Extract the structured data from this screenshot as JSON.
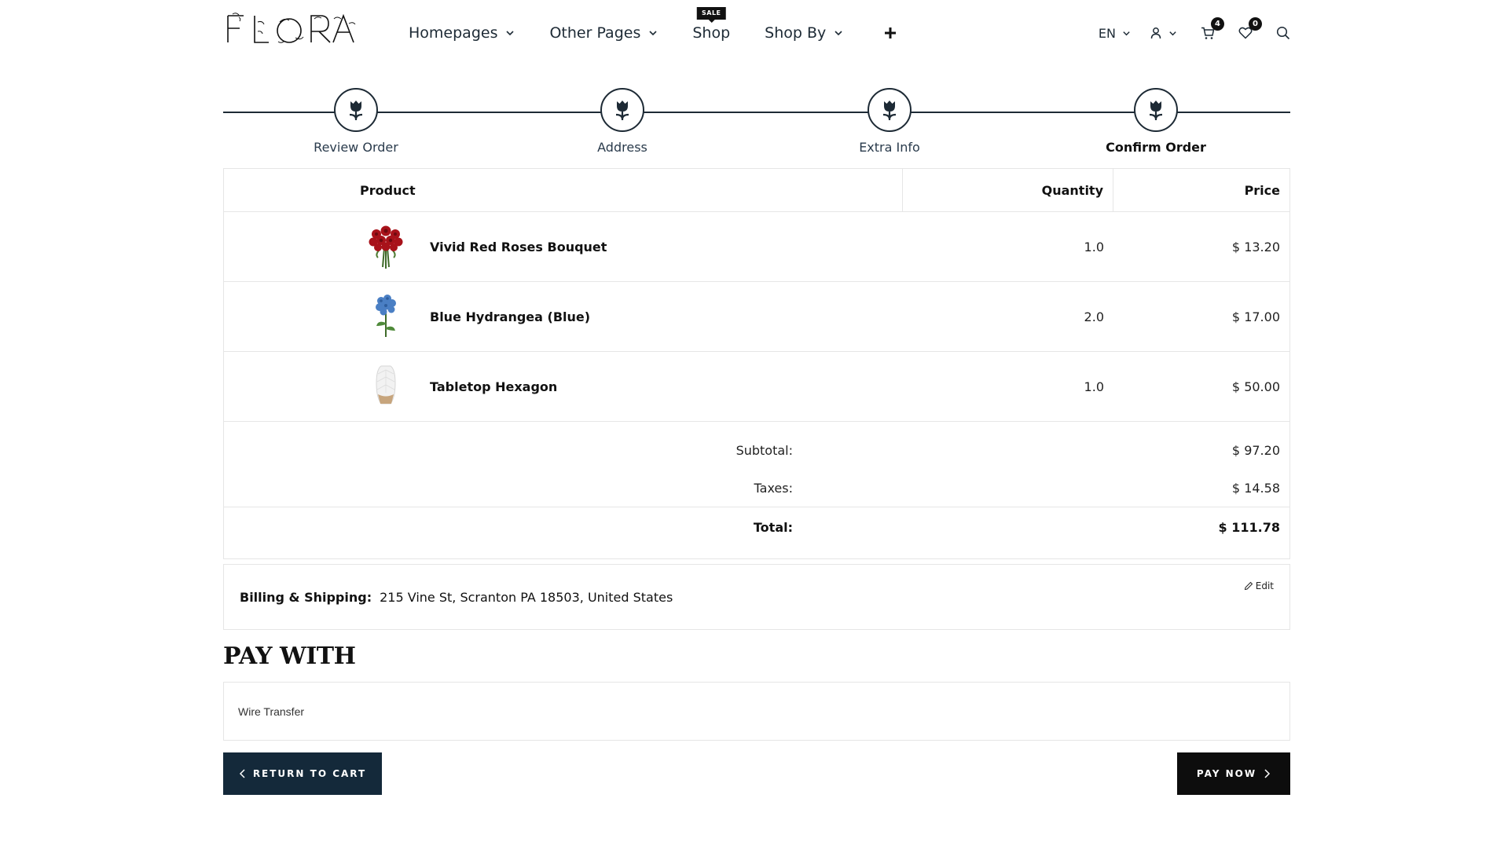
{
  "header": {
    "logo_text": "FLORA",
    "nav": [
      {
        "label": "Homepages",
        "dropdown": true
      },
      {
        "label": "Other Pages",
        "dropdown": true
      },
      {
        "label": "Shop",
        "dropdown": false,
        "badge": "SALE"
      },
      {
        "label": "Shop By",
        "dropdown": true
      }
    ],
    "plus_icon": "plus-icon",
    "language": "EN",
    "user_icon": "user-icon",
    "cart_icon": "cart-icon",
    "cart_count": "4",
    "wishlist_icon": "heart-icon",
    "wishlist_count": "0",
    "search_icon": "search-icon"
  },
  "steps": [
    {
      "label": "Review Order",
      "active": false
    },
    {
      "label": "Address",
      "active": false
    },
    {
      "label": "Extra Info",
      "active": false
    },
    {
      "label": "Confirm Order",
      "active": true
    }
  ],
  "order": {
    "columns": {
      "product": "Product",
      "quantity": "Quantity",
      "price": "Price"
    },
    "items": [
      {
        "name": "Vivid Red Roses Bouquet",
        "quantity": "1.0",
        "price": "$ 13.20",
        "thumb": "red-roses"
      },
      {
        "name": "Blue Hydrangea (Blue)",
        "quantity": "2.0",
        "price": "$ 17.00",
        "thumb": "blue-hydrangea"
      },
      {
        "name": "Tabletop Hexagon",
        "quantity": "1.0",
        "price": "$ 50.00",
        "thumb": "white-vase"
      }
    ],
    "subtotal_label": "Subtotal:",
    "subtotal": "$ 97.20",
    "taxes_label": "Taxes:",
    "taxes": "$ 14.58",
    "total_label": "Total:",
    "total": "$ 111.78"
  },
  "billing": {
    "label": "Billing & Shipping:",
    "address": "215 Vine St, Scranton PA 18503, United States",
    "edit_label": "Edit"
  },
  "payment": {
    "title": "PAY WITH",
    "method": "Wire Transfer"
  },
  "buttons": {
    "return_label": "RETURN TO CART",
    "pay_label": "PAY NOW"
  },
  "colors": {
    "primary": "#14293a",
    "dark": "#0d0d0d",
    "border": "#e6e6e6"
  }
}
